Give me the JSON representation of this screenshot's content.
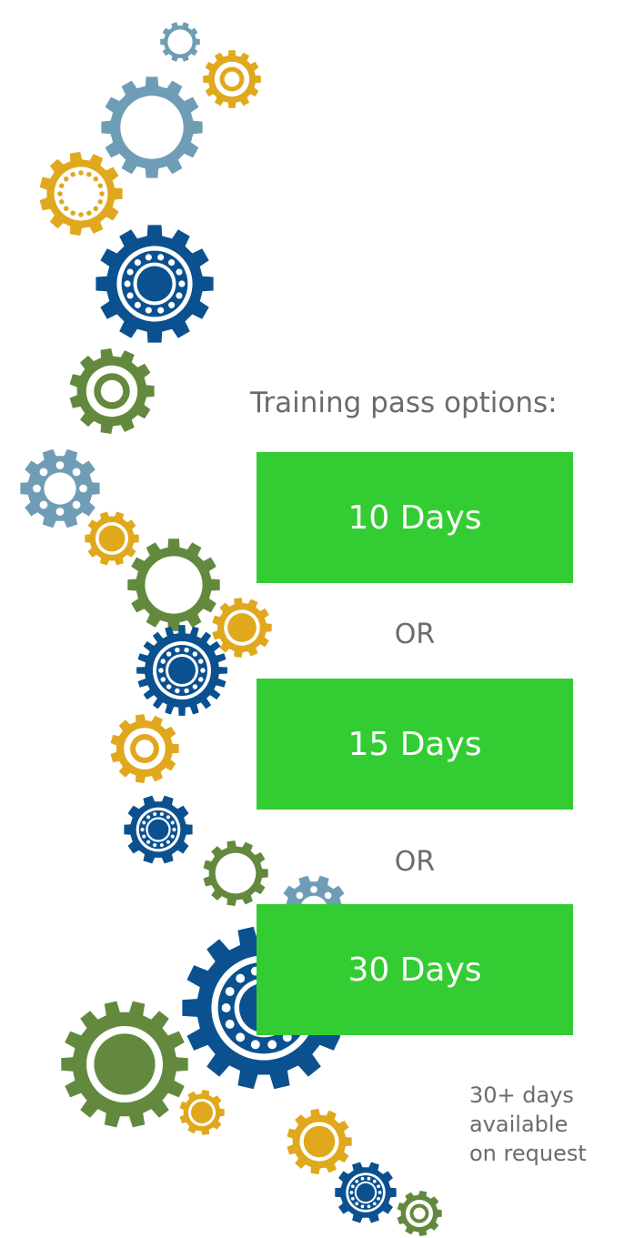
{
  "heading": "Training pass options:",
  "options": [
    "10 Days",
    "15 Days",
    "30 Days"
  ],
  "separator": "OR",
  "note": [
    "30+ days",
    "available",
    "on request"
  ],
  "colors": {
    "option_bg": "#33cc33",
    "text_gray": "#6b6b6b",
    "gear_light_blue": "#6f9db5",
    "gear_gold": "#e0a81d",
    "gear_dark_blue": "#0b5190",
    "gear_green": "#63893e"
  },
  "gears": [
    {
      "name": "gear-light-blue-small-top",
      "color": "gear_light_blue",
      "style": "ring"
    },
    {
      "name": "gear-gold-top",
      "color": "gear_gold",
      "style": "ring-core"
    },
    {
      "name": "gear-light-blue-large-top",
      "color": "gear_light_blue",
      "style": "ring"
    },
    {
      "name": "gear-gold-dotted",
      "color": "gear_gold",
      "style": "dotted"
    },
    {
      "name": "gear-dark-blue-bearing",
      "color": "gear_dark_blue",
      "style": "bearing"
    },
    {
      "name": "gear-green-ring",
      "color": "gear_green",
      "style": "ring-core"
    },
    {
      "name": "gear-light-blue-holes",
      "color": "gear_light_blue",
      "style": "holes"
    },
    {
      "name": "gear-gold-small-mid",
      "color": "gear_gold",
      "style": "solid-core"
    },
    {
      "name": "gear-green-large-mid",
      "color": "gear_green",
      "style": "ring"
    },
    {
      "name": "gear-gold-mid",
      "color": "gear_gold",
      "style": "solid-core"
    },
    {
      "name": "gear-dark-blue-bearing-mid",
      "color": "gear_dark_blue",
      "style": "bearing"
    },
    {
      "name": "gear-gold-ring-mid",
      "color": "gear_gold",
      "style": "ring-core"
    },
    {
      "name": "gear-dark-blue-small",
      "color": "gear_dark_blue",
      "style": "bearing"
    },
    {
      "name": "gear-green-small-lower",
      "color": "gear_green",
      "style": "ring"
    },
    {
      "name": "gear-light-blue-holes-lower",
      "color": "gear_light_blue",
      "style": "holes"
    },
    {
      "name": "gear-dark-blue-large",
      "color": "gear_dark_blue",
      "style": "bearing"
    },
    {
      "name": "gear-green-large-bottom",
      "color": "gear_green",
      "style": "solid-core"
    },
    {
      "name": "gear-gold-small-bottom",
      "color": "gear_gold",
      "style": "solid-core"
    },
    {
      "name": "gear-gold-bottom",
      "color": "gear_gold",
      "style": "solid-core"
    },
    {
      "name": "gear-dark-blue-bottom",
      "color": "gear_dark_blue",
      "style": "bearing"
    },
    {
      "name": "gear-green-bottom",
      "color": "gear_green",
      "style": "ring-core"
    }
  ]
}
